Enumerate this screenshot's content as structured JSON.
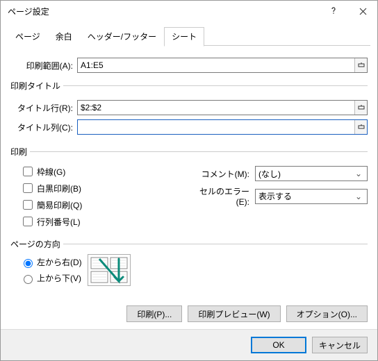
{
  "title": "ページ設定",
  "tabs": [
    "ページ",
    "余白",
    "ヘッダー/フッター",
    "シート"
  ],
  "activeTab": 3,
  "printArea": {
    "label": "印刷範囲(A):",
    "value": "A1:E5"
  },
  "printTitles": {
    "legend": "印刷タイトル",
    "row": {
      "label": "タイトル行(R):",
      "value": "$2:$2"
    },
    "col": {
      "label": "タイトル列(C):",
      "value": ""
    }
  },
  "print": {
    "legend": "印刷",
    "gridlines": "枠線(G)",
    "bw": "白黒印刷(B)",
    "draft": "簡易印刷(Q)",
    "rowcol": "行列番号(L)",
    "comments": {
      "label": "コメント(M):",
      "value": "(なし)"
    },
    "errors": {
      "label": "セルのエラー(E):",
      "value": "表示する"
    }
  },
  "pageOrder": {
    "legend": "ページの方向",
    "ltr": "左から右(D)",
    "ttb": "上から下(V)"
  },
  "buttons": {
    "print": "印刷(P)...",
    "preview": "印刷プレビュー(W)",
    "options": "オプション(O)..."
  },
  "footer": {
    "ok": "OK",
    "cancel": "キャンセル"
  }
}
